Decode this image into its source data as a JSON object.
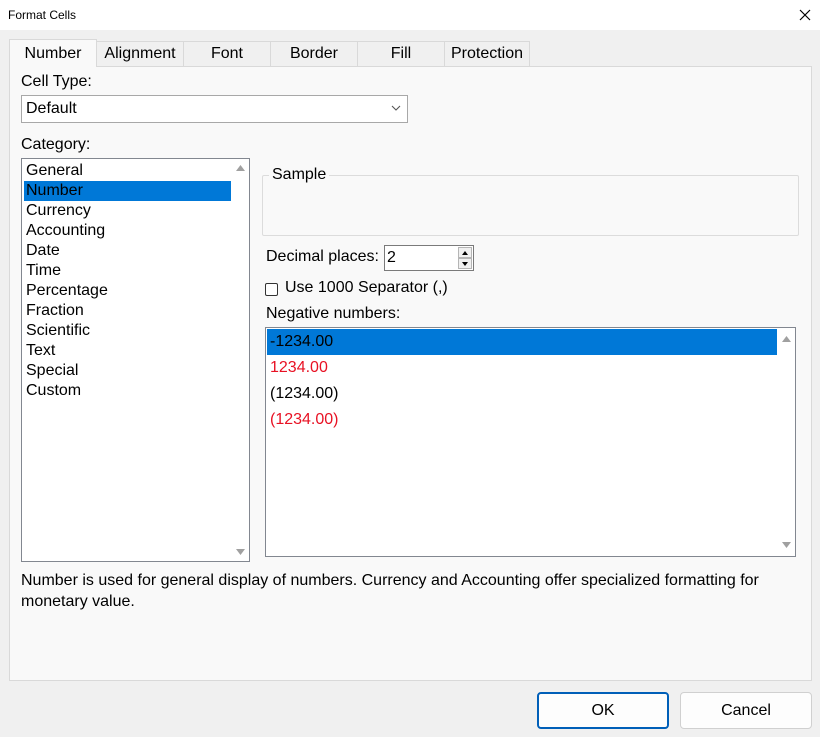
{
  "window": {
    "title": "Format Cells"
  },
  "tabs": [
    {
      "label": "Number"
    },
    {
      "label": "Alignment"
    },
    {
      "label": "Font"
    },
    {
      "label": "Border"
    },
    {
      "label": "Fill"
    },
    {
      "label": "Protection"
    }
  ],
  "cell_type": {
    "label": "Cell Type:",
    "value": "Default"
  },
  "category": {
    "label": "Category:",
    "items": [
      "General",
      "Number",
      "Currency",
      "Accounting",
      "Date",
      "Time",
      "Percentage",
      "Fraction",
      "Scientific",
      "Text",
      "Special",
      "Custom"
    ],
    "selected": "Number"
  },
  "sample": {
    "label": "Sample"
  },
  "decimal_places": {
    "label": "Decimal places:",
    "value": "2"
  },
  "separator": {
    "label": "Use 1000 Separator (,)",
    "checked": false
  },
  "negative_numbers": {
    "label": "Negative numbers:",
    "items": [
      {
        "text": "-1234.00",
        "color": "#000000",
        "selected": true
      },
      {
        "text": "1234.00",
        "color": "#e81123",
        "selected": false
      },
      {
        "text": "(1234.00)",
        "color": "#000000",
        "selected": false
      },
      {
        "text": "(1234.00)",
        "color": "#e81123",
        "selected": false
      }
    ]
  },
  "description": "Number is used for general display of numbers. Currency and Accounting offer specialized formatting for monetary value.",
  "buttons": {
    "ok": "OK",
    "cancel": "Cancel"
  },
  "colors": {
    "selection": "#0078d7",
    "negative_red": "#e81123",
    "ok_border": "#005fb8"
  }
}
